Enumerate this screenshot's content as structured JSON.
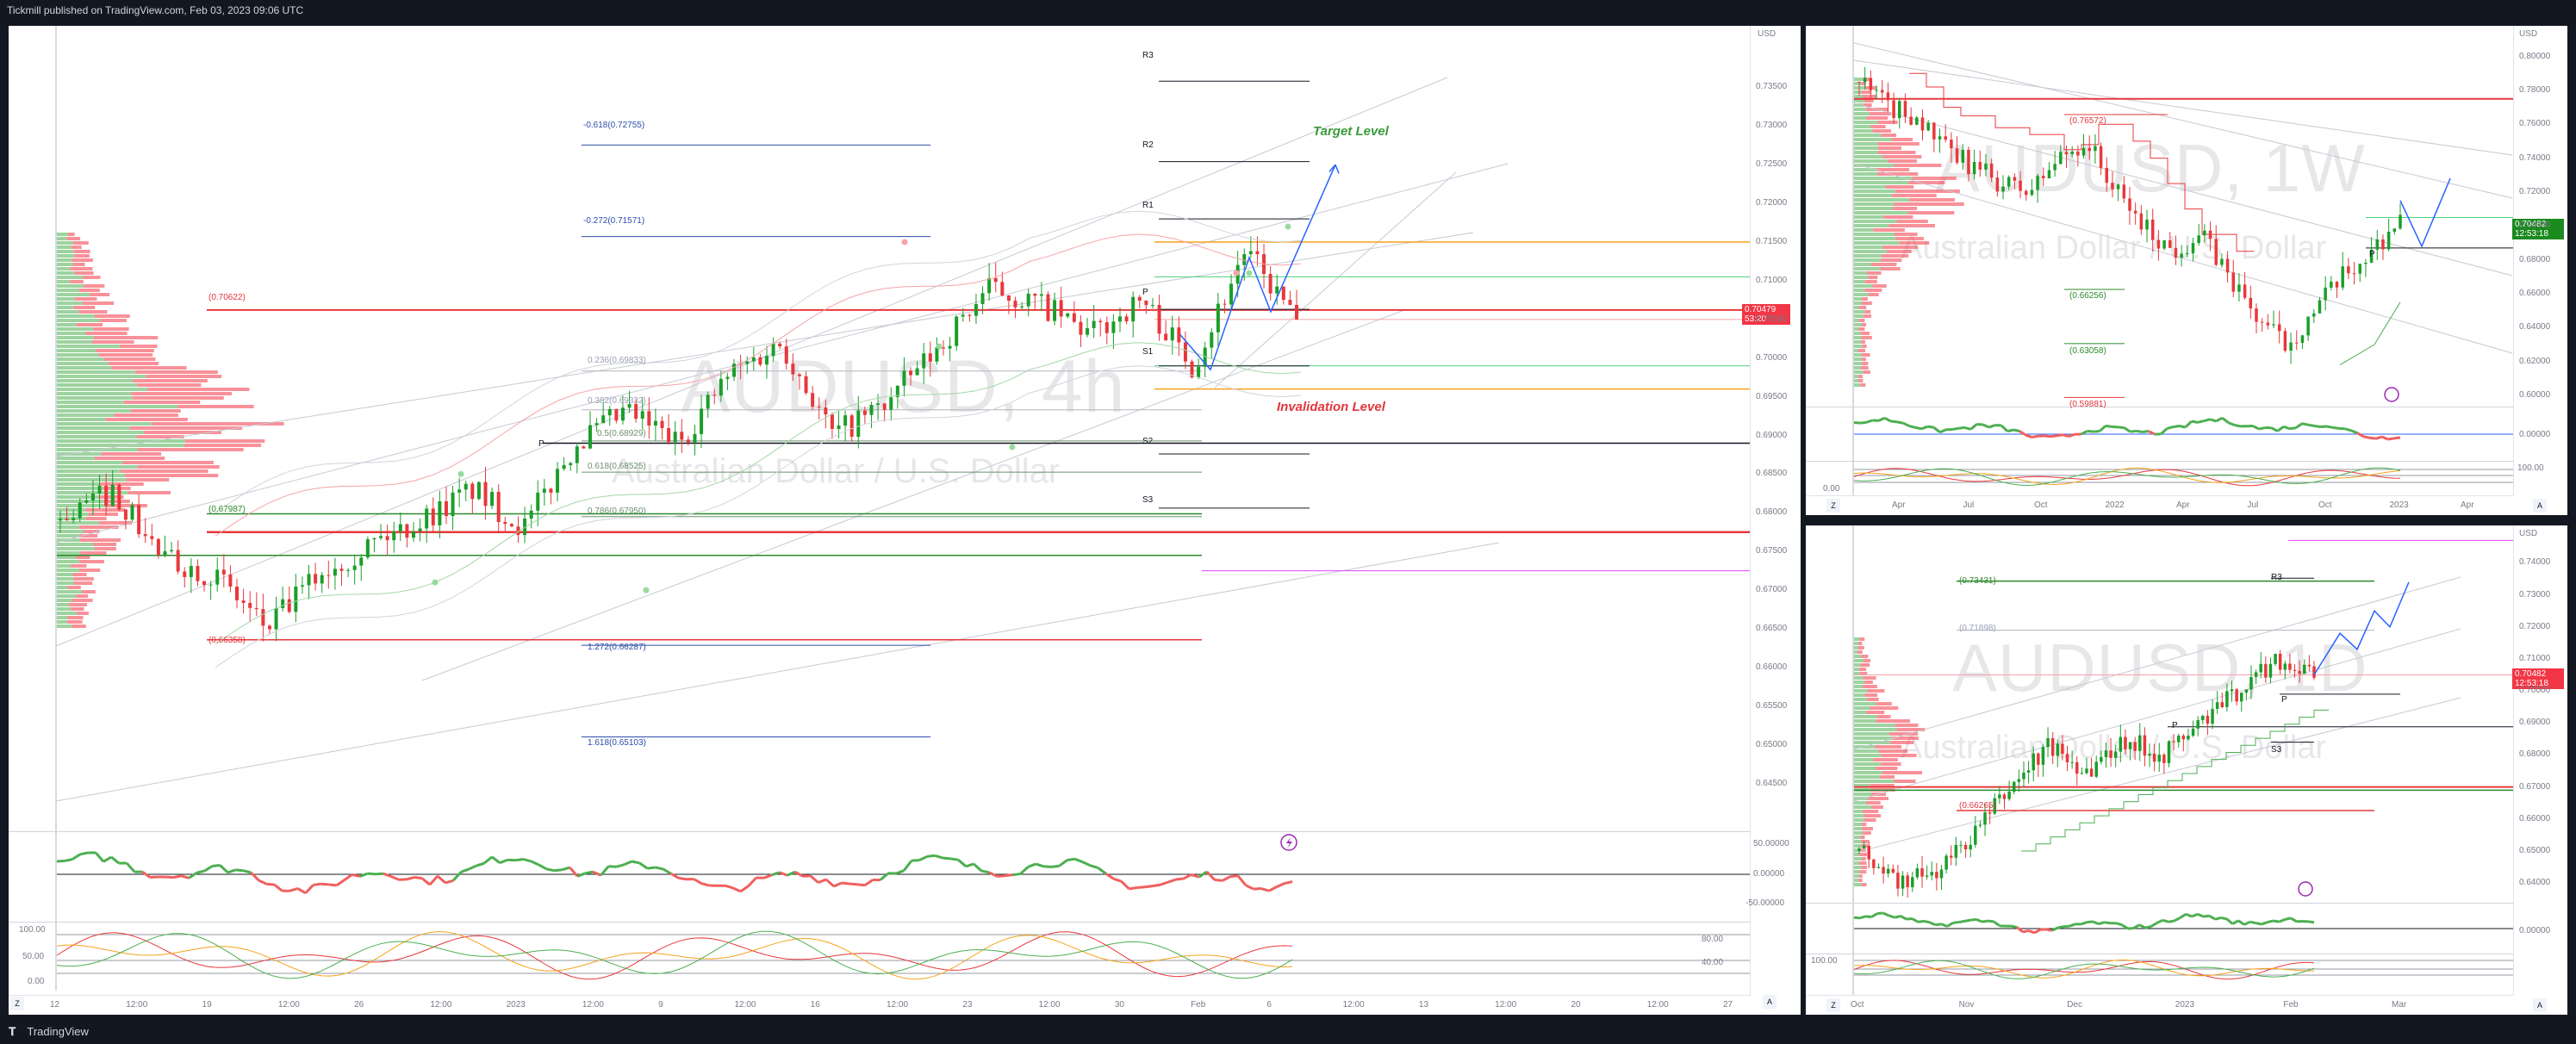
{
  "header": {
    "attribution": "Tickmill published on TradingView.com, Feb 03, 2023 09:06 UTC"
  },
  "footer": {
    "brand": "TradingView"
  },
  "colors": {
    "bull": "#089981",
    "bear": "#f23645",
    "green_candle": "#1b9e2a",
    "red_candle": "#e8383c",
    "accent_blue": "#2962ff",
    "orange": "#f7a21b"
  },
  "main": {
    "symbol_watermark": "AUDUSD, 4h",
    "desc_watermark": "Australian Dollar / U.S. Dollar",
    "currency": "USD",
    "price_ticks": [
      "0.73500",
      "0.73000",
      "0.72500",
      "0.72000",
      "0.71500",
      "0.71000",
      "0.70500",
      "0.70000",
      "0.69500",
      "0.69000",
      "0.68500",
      "0.68000",
      "0.67500",
      "0.67000",
      "0.66500",
      "0.66000",
      "0.65500",
      "0.65000",
      "0.64500"
    ],
    "time_ticks": [
      "12",
      "12:00",
      "19",
      "12:00",
      "26",
      "12:00",
      "2023",
      "12:00",
      "9",
      "12:00",
      "16",
      "12:00",
      "23",
      "12:00",
      "30",
      "Feb",
      "6",
      "12:00",
      "13",
      "12:00",
      "20",
      "12:00",
      "27"
    ],
    "last_price": "0.70479",
    "countdown": "53:20",
    "annotations": {
      "target": "Target Level",
      "invalidation": "Invalidation Level"
    },
    "pivots": {
      "r3": "R3",
      "r2": "R2",
      "r1": "R1",
      "p": "P",
      "s1": "S1",
      "s2": "S2",
      "s3": "S3",
      "p_left": "P"
    },
    "fib_ext": [
      "-0.618(0.72755)",
      "-0.272(0.71571)",
      "1.272(0.66287)",
      "1.618(0.65103)"
    ],
    "fib_ret": [
      "0.236(0.69833)",
      "0.382(0.69332)",
      "0.5(0.68929)",
      "0.618(0.68525)",
      "0.786(0.67950)"
    ],
    "level_labels": [
      "(0.70622)",
      "(0.67987)",
      "(0.66358)"
    ],
    "osc1_ticks": [
      "50.00000",
      "0.00000",
      "-50.00000"
    ],
    "osc2_ticks_left": [
      "100.00",
      "50.00",
      "0.00"
    ],
    "osc2_ticks_right": [
      "80.00",
      "40.00"
    ],
    "z": "Z",
    "a": "A"
  },
  "weekly": {
    "symbol_watermark": "AUDUSD, 1W",
    "desc_watermark": "Australian Dollar / U.S. Dollar",
    "currency": "USD",
    "price_ticks": [
      "0.80000",
      "0.78000",
      "0.76000",
      "0.74000",
      "0.72000",
      "0.70000",
      "0.68000",
      "0.66000",
      "0.64000",
      "0.62000",
      "0.60000"
    ],
    "time_ticks": [
      "Apr",
      "Jul",
      "Oct",
      "2022",
      "Apr",
      "Jul",
      "Oct",
      "2023",
      "Apr"
    ],
    "last_price": "0.70482",
    "countdown": "12:53:18",
    "level_labels": [
      "(0.76572)",
      "(0.66256)",
      "(0.63058)",
      "(0.59881)"
    ],
    "p": "P",
    "osc_ticks": [
      "0.00000"
    ],
    "osc2_ticks": [
      "100.00",
      "0.00"
    ],
    "z": "Z",
    "a": "A"
  },
  "daily": {
    "symbol_watermark": "AUDUSD, 1D",
    "desc_watermark": "Australian Dollar / U.S. Dollar",
    "currency": "USD",
    "price_ticks": [
      "0.74000",
      "0.73000",
      "0.72000",
      "0.71000",
      "0.70000",
      "0.69000",
      "0.68000",
      "0.67000",
      "0.66000",
      "0.65000",
      "0.64000"
    ],
    "time_ticks": [
      "Oct",
      "Nov",
      "Dec",
      "2023",
      "Feb",
      "Mar"
    ],
    "last_price": "0.70482",
    "countdown": "12:53:18",
    "level_labels": [
      "(0.73431)",
      "(0.71898)",
      "(0.66265)"
    ],
    "pivots": {
      "r3": "R3",
      "p": "P",
      "p2": "P",
      "s3": "S3"
    },
    "osc_ticks": [
      "0.00000"
    ],
    "osc2_ticks": [
      "100.00"
    ],
    "z": "Z",
    "a": "A"
  },
  "chart_data": [
    {
      "type": "candlestick",
      "title": "AUDUSD, 4h",
      "subtitle": "Australian Dollar / U.S. Dollar",
      "ylabel": "USD",
      "ylim": [
        0.6405,
        0.7385
      ],
      "x": [
        "Dec 12",
        "Dec 19",
        "Dec 26",
        "Jan 2",
        "Jan 9",
        "Jan 16",
        "Jan 23",
        "Jan 30",
        "Feb 3",
        "Feb 6"
      ],
      "close": [
        0.679,
        0.672,
        0.678,
        0.683,
        0.692,
        0.699,
        0.708,
        0.708,
        0.7048,
        0.713
      ],
      "last": 0.70479,
      "pivots": {
        "R3": 0.7358,
        "R2": 0.7254,
        "R1": 0.718,
        "P": 0.7063,
        "S1": 0.699,
        "S2": 0.6876,
        "S3": 0.6806
      },
      "fib_extensions": {
        "-0.618": 0.72755,
        "-0.272": 0.71571,
        "1.272": 0.66287,
        "1.618": 0.65103
      },
      "fib_retracements": {
        "0.236": 0.69833,
        "0.382": 0.69332,
        "0.5": 0.68929,
        "0.618": 0.68525,
        "0.786": 0.6795
      },
      "levels": [
        0.70622,
        0.67987,
        0.66358
      ],
      "annotations": [
        "Target Level",
        "Invalidation Level"
      ]
    },
    {
      "type": "candlestick",
      "title": "AUDUSD, 1W",
      "subtitle": "Australian Dollar / U.S. Dollar",
      "ylim": [
        0.5995,
        0.813
      ],
      "x": [
        "Apr",
        "Jul",
        "Oct",
        "2022",
        "Apr",
        "Jul",
        "Oct",
        "2023"
      ],
      "close": [
        0.772,
        0.74,
        0.723,
        0.718,
        0.748,
        0.695,
        0.64,
        0.678
      ],
      "last": 0.70482,
      "levels": [
        0.76572,
        0.66256,
        0.63058,
        0.59881
      ]
    },
    {
      "type": "candlestick",
      "title": "AUDUSD, 1D",
      "subtitle": "Australian Dollar / U.S. Dollar",
      "ylim": [
        0.636,
        0.749
      ],
      "x": [
        "Oct",
        "Nov",
        "Dec",
        "2023",
        "Feb"
      ],
      "close": [
        0.64,
        0.67,
        0.68,
        0.685,
        0.7048
      ],
      "last": 0.70482,
      "levels": [
        0.73431,
        0.71898,
        0.66265
      ]
    }
  ]
}
